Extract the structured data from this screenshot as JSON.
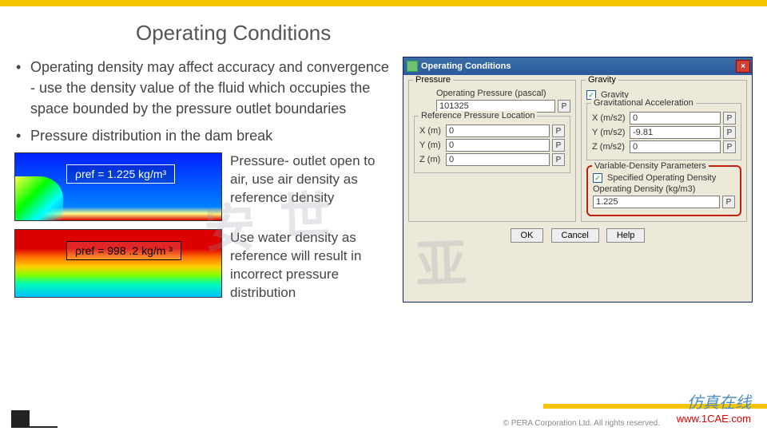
{
  "title": "Operating Conditions",
  "bullets": [
    "Operating density may affect accuracy and convergence - use the density value of the fluid which occupies the space bounded by the pressure outlet boundaries",
    "Pressure distribution in the dam break"
  ],
  "fig1": {
    "rho_label": "ρref = 1.225 kg/m³",
    "desc": "Pressure- outlet open to air, use air density as reference density"
  },
  "fig2": {
    "rho_label": "ρref = 998 .2 kg/m ³",
    "desc": "Use water density as reference will result in incorrect  pressure distribution"
  },
  "dialog": {
    "title": "Operating Conditions",
    "pressure_group": "Pressure",
    "op_press_label": "Operating Pressure (pascal)",
    "op_press_value": "101325",
    "ref_loc_group": "Reference Pressure Location",
    "x_label": "X (m)",
    "x_val": "0",
    "y_label": "Y (m)",
    "y_val": "0",
    "z_label": "Z (m)",
    "z_val": "0",
    "gravity_group": "Gravity",
    "gravity_cb": "Gravity",
    "grav_accel_group": "Gravitational Acceleration",
    "gx_label": "X (m/s2)",
    "gx_val": "0",
    "gy_label": "Y (m/s2)",
    "gy_val": "-9.81",
    "gz_label": "Z (m/s2)",
    "gz_val": "0",
    "vdp_group": "Variable-Density Parameters",
    "spec_cb": "Specified Operating Density",
    "od_label": "Operating Density (kg/m3)",
    "od_val": "1.225",
    "ok": "OK",
    "cancel": "Cancel",
    "help": "Help",
    "p_btn": "P"
  },
  "footer": {
    "copyright": "©   PERA Corporation Ltd. All rights reserved.",
    "brand_cn": "仿真在线",
    "brand_url": "www.1CAE.com"
  },
  "watermark": {
    "a": "安",
    "b": "世",
    "c": "亚"
  }
}
